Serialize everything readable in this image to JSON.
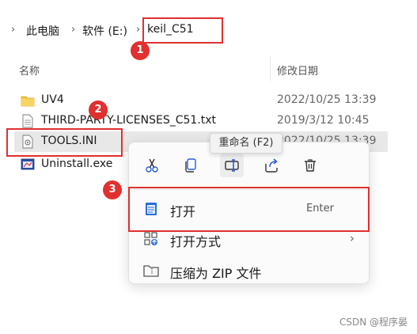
{
  "breadcrumb": {
    "items": [
      {
        "label": "此电脑"
      },
      {
        "label": "软件 (E:)"
      },
      {
        "label": "keil_C51"
      }
    ]
  },
  "columns": {
    "name": "名称",
    "modified": "修改日期"
  },
  "files": [
    {
      "name": "UV4",
      "date": "2022/10/25 13:39",
      "type": "folder"
    },
    {
      "name": "THIRD-PARTY-LICENSES_C51.txt",
      "date": "2019/3/12 10:45",
      "type": "text"
    },
    {
      "name": "TOOLS.INI",
      "date": "2022/10/25 13:39",
      "type": "ini",
      "selected": true
    },
    {
      "name": "Uninstall.exe",
      "date": "",
      "type": "exe"
    }
  ],
  "tooltip": "重命名 (F2)",
  "context_menu": {
    "quick_actions": [
      "cut-icon",
      "copy-icon",
      "rename-icon",
      "share-icon",
      "delete-icon"
    ],
    "items": [
      {
        "label": "打开",
        "shortcut": "Enter"
      },
      {
        "label": "打开方式",
        "has_submenu": true
      },
      {
        "label": "压缩为 ZIP 文件"
      }
    ]
  },
  "annotations": [
    "1",
    "2",
    "3"
  ],
  "annotation_color": "#e0302f",
  "watermark": "CSDN @程序晏"
}
